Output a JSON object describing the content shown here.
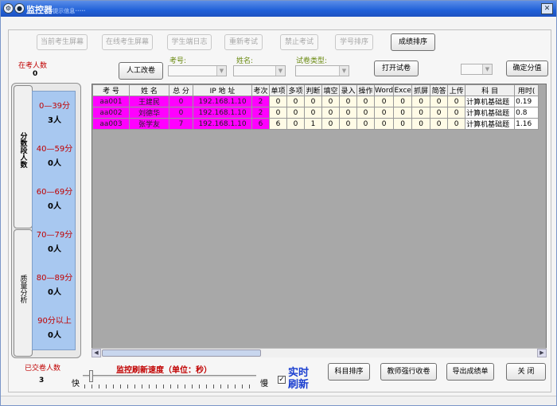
{
  "window": {
    "title": "监控器",
    "ghost_text": "·····提示信息·····"
  },
  "toolbar": {
    "buttons": [
      "当前考生屏幕",
      "在线考生屏幕",
      "学生端日志",
      "重新考试",
      "禁止考试",
      "学号排序"
    ],
    "sort_score": "成绩排序"
  },
  "left": {
    "online_label": "在考人数",
    "online_count": "0",
    "submitted_label": "已交卷人数",
    "submitted_count": "3"
  },
  "filters": {
    "manual_grade": "人工改卷",
    "exam_no_label": "考号:",
    "name_label": "姓名:",
    "paper_type_label": "试卷类型:",
    "open_paper": "打开试卷",
    "confirm_score": "确定分值"
  },
  "side_tabs": {
    "score_tab": "分数段人数",
    "quality_tab": "质量分析"
  },
  "score_bands": [
    {
      "range": "0—39分",
      "count": "3人"
    },
    {
      "range": "40—59分",
      "count": "0人"
    },
    {
      "range": "60—69分",
      "count": "0人"
    },
    {
      "range": "70—79分",
      "count": "0人"
    },
    {
      "range": "80—89分",
      "count": "0人"
    },
    {
      "range": "90分以上",
      "count": "0人"
    }
  ],
  "table": {
    "headers": [
      "考 号",
      "姓 名",
      "总 分",
      "IP 地 址",
      "考次",
      "单项",
      "多项",
      "判断",
      "填空",
      "录入",
      "操作",
      "Word",
      "Exce",
      "抓屏",
      "简答",
      "上传",
      "科  目",
      "用时("
    ],
    "rows": [
      [
        "aa001",
        "王建民",
        "0",
        "192.168.1.10",
        "2",
        "0",
        "0",
        "0",
        "0",
        "0",
        "0",
        "0",
        "0",
        "0",
        "0",
        "0",
        "计算机基础题",
        "0.19"
      ],
      [
        "aa002",
        "刘德华",
        "0",
        "192.168.1.10",
        "2",
        "0",
        "0",
        "0",
        "0",
        "0",
        "0",
        "0",
        "0",
        "0",
        "0",
        "0",
        "计算机基础题",
        "0.8"
      ],
      [
        "aa003",
        "张学友",
        "7",
        "192.168.1.10",
        "6",
        "6",
        "0",
        "1",
        "0",
        "0",
        "0",
        "0",
        "0",
        "0",
        "0",
        "0",
        "计算机基础题",
        "1.16"
      ]
    ]
  },
  "bottom": {
    "refresh_label": "监控刷新速度（单位：秒）",
    "fast": "快",
    "slow": "慢",
    "realtime": "实时刷新",
    "buttons": [
      "科目排序",
      "教师强行收卷",
      "导出成绩单",
      "关 闭"
    ]
  }
}
